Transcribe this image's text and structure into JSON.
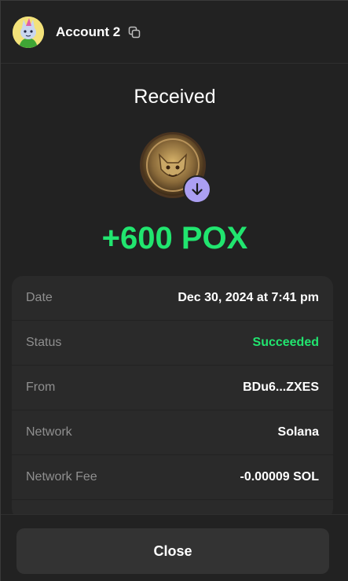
{
  "header": {
    "account_name": "Account 2"
  },
  "transaction": {
    "title": "Received",
    "amount": "+600 POX",
    "token_icon": "pox-token-icon",
    "direction_icon": "arrow-down-icon"
  },
  "details": {
    "rows": [
      {
        "label": "Date",
        "value": "Dec 30, 2024 at 7:41 pm"
      },
      {
        "label": "Status",
        "value": "Succeeded"
      },
      {
        "label": "From",
        "value": "BDu6...ZXES"
      },
      {
        "label": "Network",
        "value": "Solana"
      },
      {
        "label": "Network Fee",
        "value": "-0.00009 SOL"
      }
    ]
  },
  "footer": {
    "close_label": "Close"
  },
  "colors": {
    "background": "#222222",
    "card": "#2a2a2a",
    "success": "#21e56f",
    "accent": "#ab9ff2",
    "button": "#333333"
  }
}
